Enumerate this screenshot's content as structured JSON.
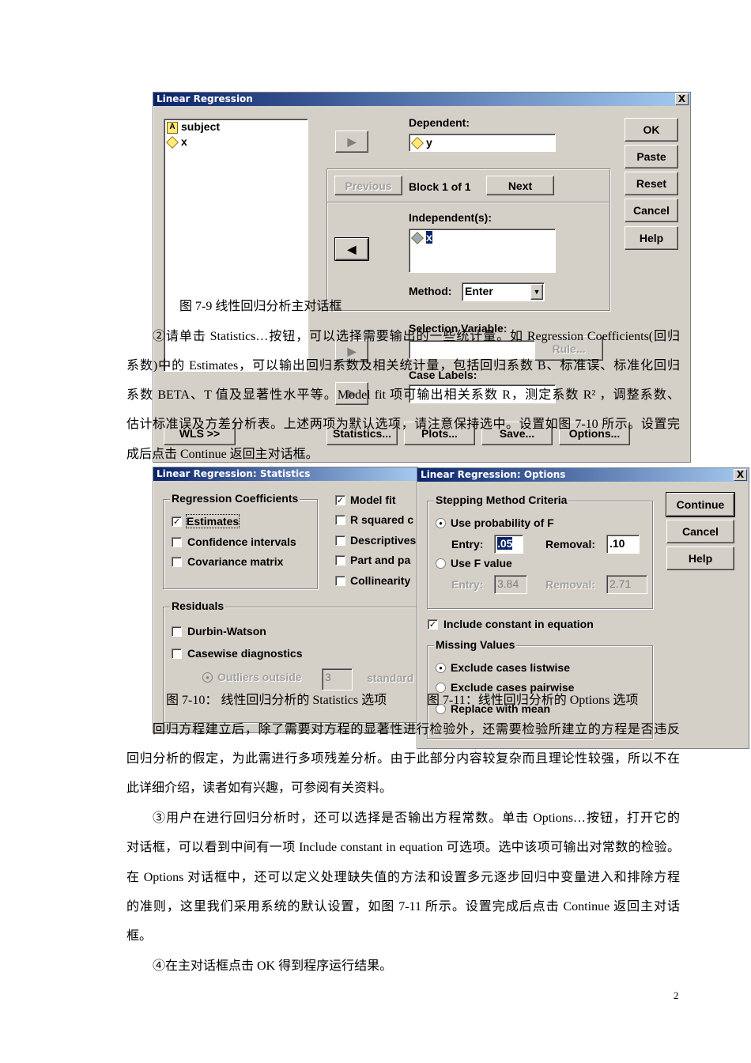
{
  "main_dialog": {
    "title": "Linear Regression",
    "close": "X",
    "variables": [
      "subject",
      "x"
    ],
    "dependent_label": "Dependent:",
    "dependent_value": "y",
    "previous": "Previous",
    "block": "Block 1 of 1",
    "next": "Next",
    "independent_label": "Independent(s):",
    "independent_value": "x",
    "method_label": "Method:",
    "method_value": "Enter",
    "selection_label": "Selection Variable:",
    "rule": "Rule...",
    "case_label": "Case Labels:",
    "buttons": {
      "ok": "OK",
      "paste": "Paste",
      "reset": "Reset",
      "cancel": "Cancel",
      "help": "Help",
      "wls": "WLS >>",
      "statistics": "Statistics...",
      "plots": "Plots...",
      "save": "Save...",
      "options": "Options..."
    }
  },
  "stats_dialog": {
    "title": "Linear Regression: Statistics",
    "coef_group": "Regression Coefficients",
    "estimates": "Estimates",
    "confidence": "Confidence intervals",
    "covariance": "Covariance matrix",
    "model_fit": "Model fit",
    "r_squared": "R squared c",
    "descriptives": "Descriptives",
    "part": "Part and pa",
    "collinearity": "Collinearity",
    "residuals_group": "Residuals",
    "durbin": "Durbin-Watson",
    "casewise": "Casewise diagnostics",
    "outliers": "Outliers outside",
    "outliers_value": "3",
    "standard": "standard",
    "checked": {
      "estimates": true,
      "model_fit": true
    }
  },
  "options_dialog": {
    "title": "Linear Regression: Options",
    "close": "X",
    "stepping_group": "Stepping Method Criteria",
    "use_prob": "Use probability of F",
    "entry": "Entry:",
    "entry_value": ".05",
    "removal": "Removal:",
    "removal_value": ".10",
    "use_f": "Use F value",
    "f_entry_value": "3.84",
    "f_removal_value": "2.71",
    "include_constant": "Include constant in equation",
    "missing_group": "Missing Values",
    "listwise": "Exclude cases listwise",
    "pairwise": "Exclude cases pairwise",
    "replace": "Replace with mean",
    "continue": "Continue",
    "cancel": "Cancel",
    "help": "Help"
  },
  "captions": {
    "fig79": "图 7-9  线性回归分析主对话框",
    "fig710": "图 7-10：  线性回归分析的 Statistics 选项",
    "fig711": "图 7-11：线性回归分析的 Options 选项"
  },
  "text": [
    "②请单击 Statistics…按钮，可以选择需要输出的一些统计量。如 Regression Coefficients(回归",
    "系数)中的 Estimates，可以输出回归系数及相关统计量，包括回归系数 B、标准误、标准化回归",
    "系数 BETA、T 值及显著性水平等。Model fit 项可输出相关系数 R，测定系数 R² ，调整系数、",
    "估计标准误及方差分析表。上述两项为默认选项，请注意保持选中。设置如图 7-10 所示。设置完",
    "成后点击 Continue 返回主对话框。",
    "回归方程建立后，除了需要对方程的显著性进行检验外，还需要检验所建立的方程是否违反",
    "回归分析的假定，为此需进行多项残差分析。由于此部分内容较复杂而且理论性较强，所以不在",
    "此详细介绍，读者如有兴趣，可参阅有关资料。",
    "③用户在进行回归分析时，还可以选择是否输出方程常数。单击 Options…按钮，打开它的",
    "对话框，可以看到中间有一项 Include constant in equation 可选项。选中该项可输出对常数的检验。",
    "在 Options 对话框中，还可以定义处理缺失值的方法和设置多元逐步回归中变量进入和排除方程",
    "的准则，这里我们采用系统的默认设置，如图 7-11 所示。设置完成后点击 Continue 返回主对话",
    "框。",
    "④在主对话框点击 OK 得到程序运行结果。"
  ],
  "page_number": "2",
  "colors": {
    "titlebar": "#0a246a",
    "dialog": "#d4d0c8"
  }
}
